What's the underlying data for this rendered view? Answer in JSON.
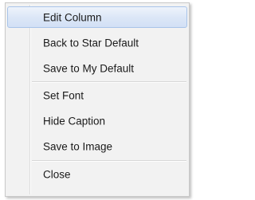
{
  "context_menu": {
    "items": [
      {
        "label": "Edit Column",
        "highlighted": true
      },
      {
        "label": "Back to Star Default"
      },
      {
        "label": "Save to My Default"
      },
      {
        "label": "Set Font"
      },
      {
        "label": "Hide Caption"
      },
      {
        "label": "Save to Image"
      },
      {
        "label": "Close"
      }
    ]
  },
  "colors": {
    "menu_background": "#f2f2f2",
    "highlight": "#dce7f7",
    "highlight_border": "#a8c4e9",
    "text": "#1a1a1a"
  }
}
